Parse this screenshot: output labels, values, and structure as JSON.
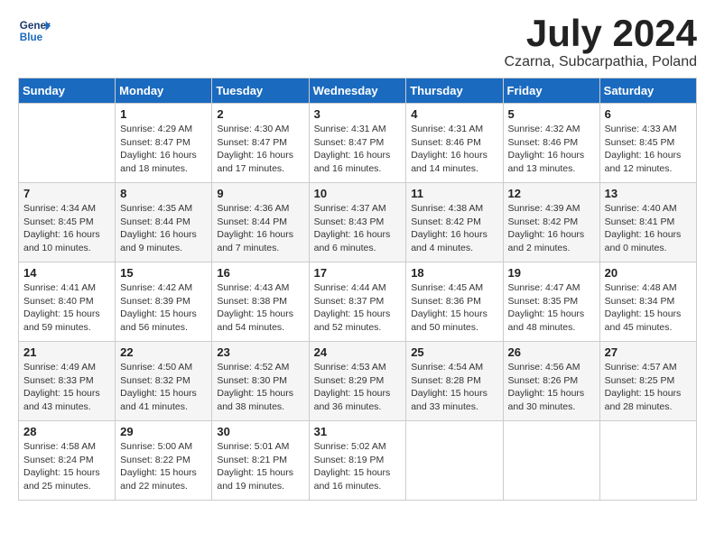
{
  "header": {
    "logo_line1": "General",
    "logo_line2": "Blue",
    "month_year": "July 2024",
    "location": "Czarna, Subcarpathia, Poland"
  },
  "days_of_week": [
    "Sunday",
    "Monday",
    "Tuesday",
    "Wednesday",
    "Thursday",
    "Friday",
    "Saturday"
  ],
  "weeks": [
    [
      {
        "day": "",
        "sunrise": "",
        "sunset": "",
        "daylight": ""
      },
      {
        "day": "1",
        "sunrise": "Sunrise: 4:29 AM",
        "sunset": "Sunset: 8:47 PM",
        "daylight": "Daylight: 16 hours and 18 minutes."
      },
      {
        "day": "2",
        "sunrise": "Sunrise: 4:30 AM",
        "sunset": "Sunset: 8:47 PM",
        "daylight": "Daylight: 16 hours and 17 minutes."
      },
      {
        "day": "3",
        "sunrise": "Sunrise: 4:31 AM",
        "sunset": "Sunset: 8:47 PM",
        "daylight": "Daylight: 16 hours and 16 minutes."
      },
      {
        "day": "4",
        "sunrise": "Sunrise: 4:31 AM",
        "sunset": "Sunset: 8:46 PM",
        "daylight": "Daylight: 16 hours and 14 minutes."
      },
      {
        "day": "5",
        "sunrise": "Sunrise: 4:32 AM",
        "sunset": "Sunset: 8:46 PM",
        "daylight": "Daylight: 16 hours and 13 minutes."
      },
      {
        "day": "6",
        "sunrise": "Sunrise: 4:33 AM",
        "sunset": "Sunset: 8:45 PM",
        "daylight": "Daylight: 16 hours and 12 minutes."
      }
    ],
    [
      {
        "day": "7",
        "sunrise": "Sunrise: 4:34 AM",
        "sunset": "Sunset: 8:45 PM",
        "daylight": "Daylight: 16 hours and 10 minutes."
      },
      {
        "day": "8",
        "sunrise": "Sunrise: 4:35 AM",
        "sunset": "Sunset: 8:44 PM",
        "daylight": "Daylight: 16 hours and 9 minutes."
      },
      {
        "day": "9",
        "sunrise": "Sunrise: 4:36 AM",
        "sunset": "Sunset: 8:44 PM",
        "daylight": "Daylight: 16 hours and 7 minutes."
      },
      {
        "day": "10",
        "sunrise": "Sunrise: 4:37 AM",
        "sunset": "Sunset: 8:43 PM",
        "daylight": "Daylight: 16 hours and 6 minutes."
      },
      {
        "day": "11",
        "sunrise": "Sunrise: 4:38 AM",
        "sunset": "Sunset: 8:42 PM",
        "daylight": "Daylight: 16 hours and 4 minutes."
      },
      {
        "day": "12",
        "sunrise": "Sunrise: 4:39 AM",
        "sunset": "Sunset: 8:42 PM",
        "daylight": "Daylight: 16 hours and 2 minutes."
      },
      {
        "day": "13",
        "sunrise": "Sunrise: 4:40 AM",
        "sunset": "Sunset: 8:41 PM",
        "daylight": "Daylight: 16 hours and 0 minutes."
      }
    ],
    [
      {
        "day": "14",
        "sunrise": "Sunrise: 4:41 AM",
        "sunset": "Sunset: 8:40 PM",
        "daylight": "Daylight: 15 hours and 59 minutes."
      },
      {
        "day": "15",
        "sunrise": "Sunrise: 4:42 AM",
        "sunset": "Sunset: 8:39 PM",
        "daylight": "Daylight: 15 hours and 56 minutes."
      },
      {
        "day": "16",
        "sunrise": "Sunrise: 4:43 AM",
        "sunset": "Sunset: 8:38 PM",
        "daylight": "Daylight: 15 hours and 54 minutes."
      },
      {
        "day": "17",
        "sunrise": "Sunrise: 4:44 AM",
        "sunset": "Sunset: 8:37 PM",
        "daylight": "Daylight: 15 hours and 52 minutes."
      },
      {
        "day": "18",
        "sunrise": "Sunrise: 4:45 AM",
        "sunset": "Sunset: 8:36 PM",
        "daylight": "Daylight: 15 hours and 50 minutes."
      },
      {
        "day": "19",
        "sunrise": "Sunrise: 4:47 AM",
        "sunset": "Sunset: 8:35 PM",
        "daylight": "Daylight: 15 hours and 48 minutes."
      },
      {
        "day": "20",
        "sunrise": "Sunrise: 4:48 AM",
        "sunset": "Sunset: 8:34 PM",
        "daylight": "Daylight: 15 hours and 45 minutes."
      }
    ],
    [
      {
        "day": "21",
        "sunrise": "Sunrise: 4:49 AM",
        "sunset": "Sunset: 8:33 PM",
        "daylight": "Daylight: 15 hours and 43 minutes."
      },
      {
        "day": "22",
        "sunrise": "Sunrise: 4:50 AM",
        "sunset": "Sunset: 8:32 PM",
        "daylight": "Daylight: 15 hours and 41 minutes."
      },
      {
        "day": "23",
        "sunrise": "Sunrise: 4:52 AM",
        "sunset": "Sunset: 8:30 PM",
        "daylight": "Daylight: 15 hours and 38 minutes."
      },
      {
        "day": "24",
        "sunrise": "Sunrise: 4:53 AM",
        "sunset": "Sunset: 8:29 PM",
        "daylight": "Daylight: 15 hours and 36 minutes."
      },
      {
        "day": "25",
        "sunrise": "Sunrise: 4:54 AM",
        "sunset": "Sunset: 8:28 PM",
        "daylight": "Daylight: 15 hours and 33 minutes."
      },
      {
        "day": "26",
        "sunrise": "Sunrise: 4:56 AM",
        "sunset": "Sunset: 8:26 PM",
        "daylight": "Daylight: 15 hours and 30 minutes."
      },
      {
        "day": "27",
        "sunrise": "Sunrise: 4:57 AM",
        "sunset": "Sunset: 8:25 PM",
        "daylight": "Daylight: 15 hours and 28 minutes."
      }
    ],
    [
      {
        "day": "28",
        "sunrise": "Sunrise: 4:58 AM",
        "sunset": "Sunset: 8:24 PM",
        "daylight": "Daylight: 15 hours and 25 minutes."
      },
      {
        "day": "29",
        "sunrise": "Sunrise: 5:00 AM",
        "sunset": "Sunset: 8:22 PM",
        "daylight": "Daylight: 15 hours and 22 minutes."
      },
      {
        "day": "30",
        "sunrise": "Sunrise: 5:01 AM",
        "sunset": "Sunset: 8:21 PM",
        "daylight": "Daylight: 15 hours and 19 minutes."
      },
      {
        "day": "31",
        "sunrise": "Sunrise: 5:02 AM",
        "sunset": "Sunset: 8:19 PM",
        "daylight": "Daylight: 15 hours and 16 minutes."
      },
      {
        "day": "",
        "sunrise": "",
        "sunset": "",
        "daylight": ""
      },
      {
        "day": "",
        "sunrise": "",
        "sunset": "",
        "daylight": ""
      },
      {
        "day": "",
        "sunrise": "",
        "sunset": "",
        "daylight": ""
      }
    ]
  ]
}
